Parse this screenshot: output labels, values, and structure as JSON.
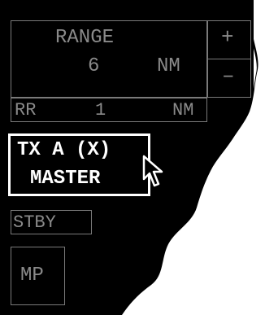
{
  "range_panel": {
    "label": "RANGE",
    "value": "6",
    "unit": "NM",
    "increase_label": "+",
    "decrease_label": "–"
  },
  "range_rings": {
    "label": "RR",
    "value": "1",
    "unit": "NM"
  },
  "tx_button": {
    "line1": "TX A (X)",
    "line2": "MASTER"
  },
  "stby_button": {
    "label": "STBY"
  },
  "mp_button": {
    "label": "MP"
  },
  "colors": {
    "background": "#000000",
    "page": "#ffffff",
    "dim_text": "#8a8a8a",
    "border": "#7a7a7a",
    "highlight": "#ffffff"
  },
  "icons": [
    "mouse-pointer-icon"
  ]
}
